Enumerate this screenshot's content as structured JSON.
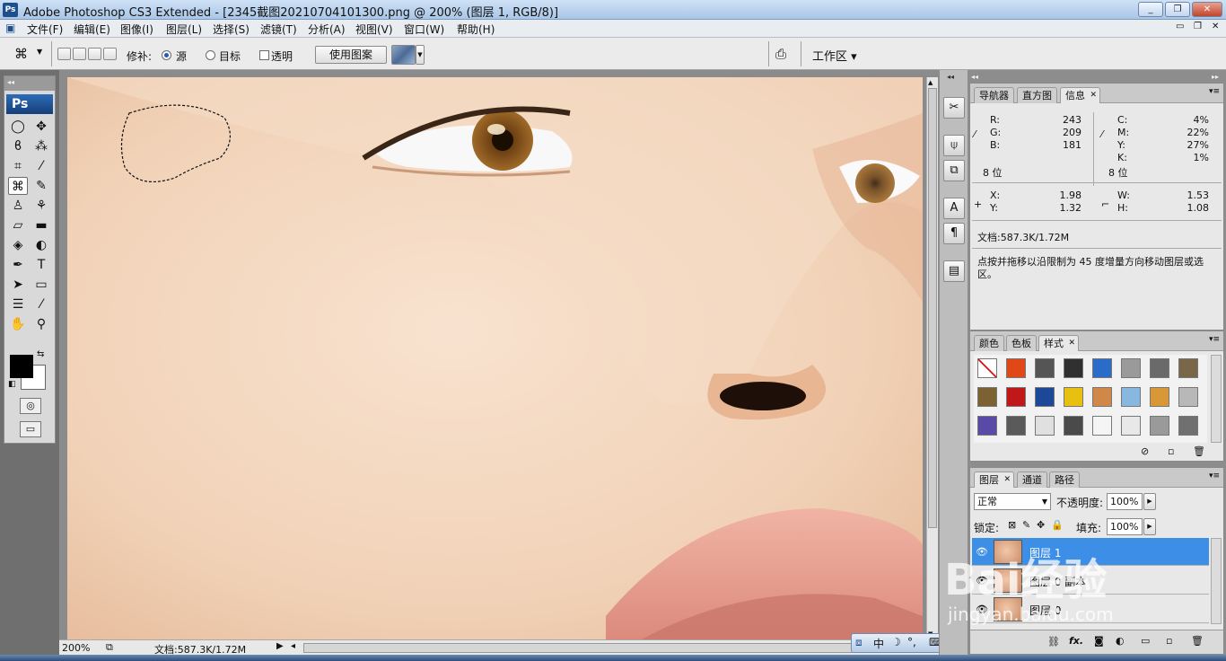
{
  "window": {
    "icon": "Ps",
    "title": "Adobe Photoshop CS3 Extended - [2345截图20210704101300.png @ 200% (图层 1, RGB/8)]",
    "controls": [
      "_",
      "❐",
      "✕"
    ]
  },
  "menu": [
    "文件(F)",
    "编辑(E)",
    "图像(I)",
    "图层(L)",
    "选择(S)",
    "滤镜(T)",
    "分析(A)",
    "视图(V)",
    "窗口(W)",
    "帮助(H)"
  ],
  "options": {
    "patch_label": "修补:",
    "source_label": "源",
    "destination_label": "目标",
    "transparent_label": "透明",
    "use_pattern_label": "使用图案",
    "workspace_label": "工作区 ▾"
  },
  "toolbox": {
    "logo": "Ps",
    "tools": [
      [
        "marquee-ellipse",
        "◯"
      ],
      [
        "move",
        "✥"
      ],
      [
        "lasso",
        "ϐ"
      ],
      [
        "magic-wand",
        "⁂"
      ],
      [
        "crop",
        "⌗"
      ],
      [
        "slice",
        "⁄"
      ],
      [
        "patch",
        "⌘"
      ],
      [
        "brush",
        "✎"
      ],
      [
        "stamp",
        "♙"
      ],
      [
        "history-brush",
        "⚘"
      ],
      [
        "eraser",
        "▱"
      ],
      [
        "gradient",
        "▬"
      ],
      [
        "blur",
        "◈"
      ],
      [
        "dodge",
        "◐"
      ],
      [
        "pen",
        "✒"
      ],
      [
        "type",
        "T"
      ],
      [
        "path-select",
        "➤"
      ],
      [
        "shape",
        "▭"
      ],
      [
        "notes",
        "☰"
      ],
      [
        "eyedropper",
        "⁄"
      ],
      [
        "hand",
        "✋"
      ],
      [
        "zoom",
        "⚲"
      ]
    ]
  },
  "status": {
    "zoom": "200%",
    "doc": "文档:587.3K/1.72M"
  },
  "info_panel": {
    "tabs": [
      "导航器",
      "直方图",
      "信息"
    ],
    "rgb": [
      [
        "R:",
        "243"
      ],
      [
        "G:",
        "209"
      ],
      [
        "B:",
        "181"
      ]
    ],
    "cmyk": [
      [
        "C:",
        "4%"
      ],
      [
        "M:",
        "22%"
      ],
      [
        "Y:",
        "27%"
      ],
      [
        "K:",
        "1%"
      ]
    ],
    "bits_left": "8 位",
    "bits_right": "8 位",
    "xy": [
      [
        "X:",
        "1.98"
      ],
      [
        "Y:",
        "1.32"
      ]
    ],
    "wh": [
      [
        "W:",
        "1.53"
      ],
      [
        "H:",
        "1.08"
      ]
    ],
    "doc": "文档:587.3K/1.72M",
    "hint": "点按并拖移以沿限制为 45 度增量方向移动图层或选区。"
  },
  "styles_panel": {
    "tabs": [
      "颜色",
      "色板",
      "样式"
    ],
    "swatches": [
      "#ffffff",
      "#e04818",
      "#555555",
      "#303030",
      "#2a6cc8",
      "#9a9a9a",
      "#6a6a6a",
      "#7a6648",
      "#7c6232",
      "#c01818",
      "#1c4898",
      "#e8c010",
      "#d08848",
      "#88b8e0",
      "#d89838",
      "#b8b8b8",
      "#5a4aa8",
      "#5a5a5a",
      "#e0e0e0",
      "#4a4a4a",
      "#f5f5f5",
      "#e8e8e8",
      "#9a9a9a",
      "#707070"
    ]
  },
  "layers_panel": {
    "tabs": [
      "图层",
      "通道",
      "路径"
    ],
    "blend_mode": "正常",
    "opacity_label": "不透明度:",
    "opacity": "100%",
    "lock_label": "锁定:",
    "fill_label": "填充:",
    "fill": "100%",
    "layers": [
      "图层 1",
      "图层 0 副本",
      "图层 0"
    ]
  },
  "ime_bar": [
    "中",
    "☽",
    "°,",
    "⌨",
    "♟",
    "🔧"
  ],
  "watermark": {
    "brand": "Bai经验",
    "url": "jingyan.baidu.com"
  }
}
